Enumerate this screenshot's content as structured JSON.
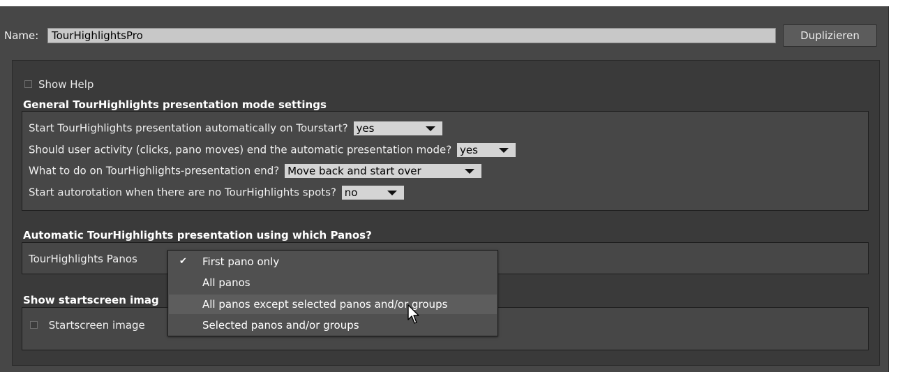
{
  "name_row": {
    "label": "Name:",
    "value": "TourHighlightsPro",
    "duplicate_label": "Duplizieren"
  },
  "show_help": {
    "label": "Show Help",
    "checked": false
  },
  "general": {
    "heading": "General TourHighlights presentation mode settings",
    "q1": {
      "label": "Start TourHighlights presentation automatically on Tourstart?",
      "value": "yes"
    },
    "q2": {
      "label": "Should user activity (clicks, pano moves) end the automatic presentation mode?",
      "value": "yes"
    },
    "q3": {
      "label": "What to do on TourHighlights-presentation end?",
      "value": "Move back and start over"
    },
    "q4": {
      "label": "Start autorotation when there are no TourHighlights spots?",
      "value": "no"
    }
  },
  "panos": {
    "heading": "Automatic TourHighlights presentation using which Panos?",
    "label": "TourHighlights Panos",
    "options": [
      {
        "label": "First pano only",
        "checked": true
      },
      {
        "label": "All panos",
        "checked": false
      },
      {
        "label": "All panos except selected panos and/or groups",
        "checked": false,
        "highlighted": true
      },
      {
        "label": "Selected panos and/or groups",
        "checked": false
      }
    ],
    "check_glyph": "✔"
  },
  "startscreen": {
    "heading_visible": "Show startscreen imag",
    "checkbox_label": "Startscreen image",
    "checked": false
  },
  "colors": {
    "background": "#474747",
    "panel": "#3a3a3a",
    "select_bg": "#d4d4d4",
    "popup_bg": "#505050",
    "popup_highlight": "#5d5d5d"
  },
  "icons": {
    "dropdown": "triangle-down",
    "cursor": "arrow-pointer"
  }
}
